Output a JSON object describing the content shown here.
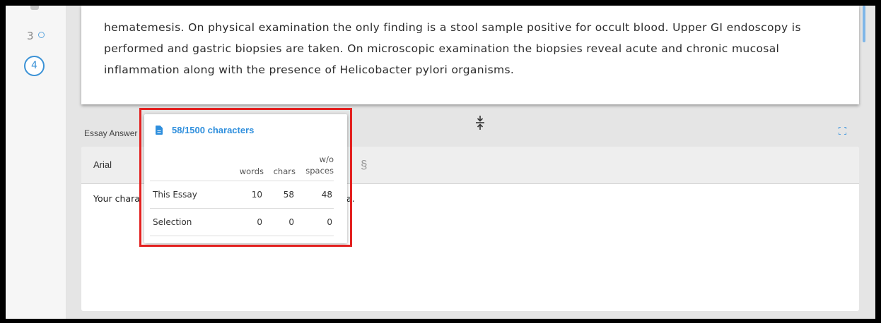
{
  "sidebar": {
    "items": [
      {
        "label": "3"
      },
      {
        "label": "4"
      }
    ]
  },
  "question": {
    "text": "hematemesis. On physical examination the only finding is a stool sample positive for occult blood. Upper GI endoscopy is\nperformed and gastric biopsies are taken. On microscopic examination the biopsies reveal acute and chronic mucosal\ninflammation along with the presence of Helicobacter pylori organisms."
  },
  "essay": {
    "label": "Essay Answer",
    "font": "Arial",
    "section_symbol": "§",
    "body_text_visible_left": "Your chara",
    "body_text_visible_right": "a."
  },
  "counter_popup": {
    "header": "58/1500 characters",
    "columns": {
      "words": "words",
      "chars": "chars",
      "nospaces": "w/o\nspaces"
    },
    "rows": [
      {
        "label": "This Essay",
        "words": "10",
        "chars": "58",
        "nospaces": "48"
      },
      {
        "label": "Selection",
        "words": "0",
        "chars": "0",
        "nospaces": "0"
      }
    ]
  },
  "icons": {
    "doc": "document-icon",
    "splitter": "split-resize-icon",
    "fullscreen": "fullscreen-icon"
  },
  "colors": {
    "accent": "#2f8fdd",
    "highlight": "#e32120"
  }
}
